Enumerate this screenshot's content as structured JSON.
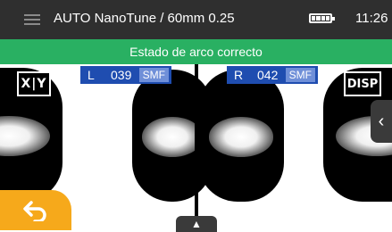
{
  "header": {
    "title": "AUTO NanoTune / 60mm 0.25",
    "time": "11:26"
  },
  "status": {
    "message": "Estado de arco correcto"
  },
  "left_readout": {
    "side": "L",
    "value": "039",
    "fiber": "SMF"
  },
  "right_readout": {
    "side": "R",
    "value": "042",
    "fiber": "SMF"
  },
  "buttons": {
    "xy_label": "X|Y",
    "disp_label": "DISP"
  },
  "icons": {
    "menu": "menu-icon",
    "battery": "battery-icon",
    "side_tab": "chevron-left-icon",
    "back": "back-arrow-icon",
    "bottom_tab": "chevron-up-icon"
  },
  "colors": {
    "topbar": "#2f2f2f",
    "status_ok": "#29b062",
    "readout": "#1f4db0",
    "back_button": "#f6a91b"
  },
  "battery_level": 1.0
}
